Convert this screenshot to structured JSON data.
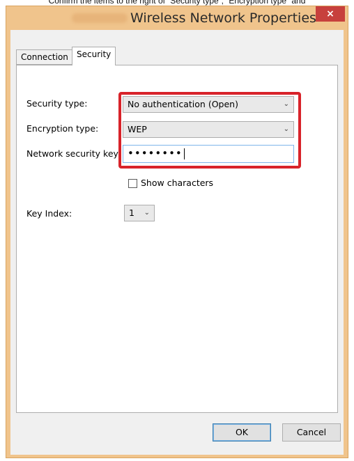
{
  "caption": "Confirm the items to the right of “Security type”, “Encryption type” and",
  "window": {
    "title": "Wireless Network Properties",
    "close_glyph": "×"
  },
  "tabs": [
    {
      "label": "Connection",
      "active": false
    },
    {
      "label": "Security",
      "active": true
    }
  ],
  "security": {
    "security_type_label": "Security type:",
    "security_type_value": "No authentication (Open)",
    "encryption_type_label": "Encryption type:",
    "encryption_type_value": "WEP",
    "network_key_label": "Network security key",
    "network_key_value": "••••••••",
    "show_characters_label": "Show characters",
    "show_characters_checked": false,
    "key_index_label": "Key Index:",
    "key_index_value": "1"
  },
  "buttons": {
    "ok": "OK",
    "cancel": "Cancel"
  },
  "colors": {
    "frame": "#f0c48c",
    "close": "#c7403d",
    "highlight": "#d8232a"
  }
}
